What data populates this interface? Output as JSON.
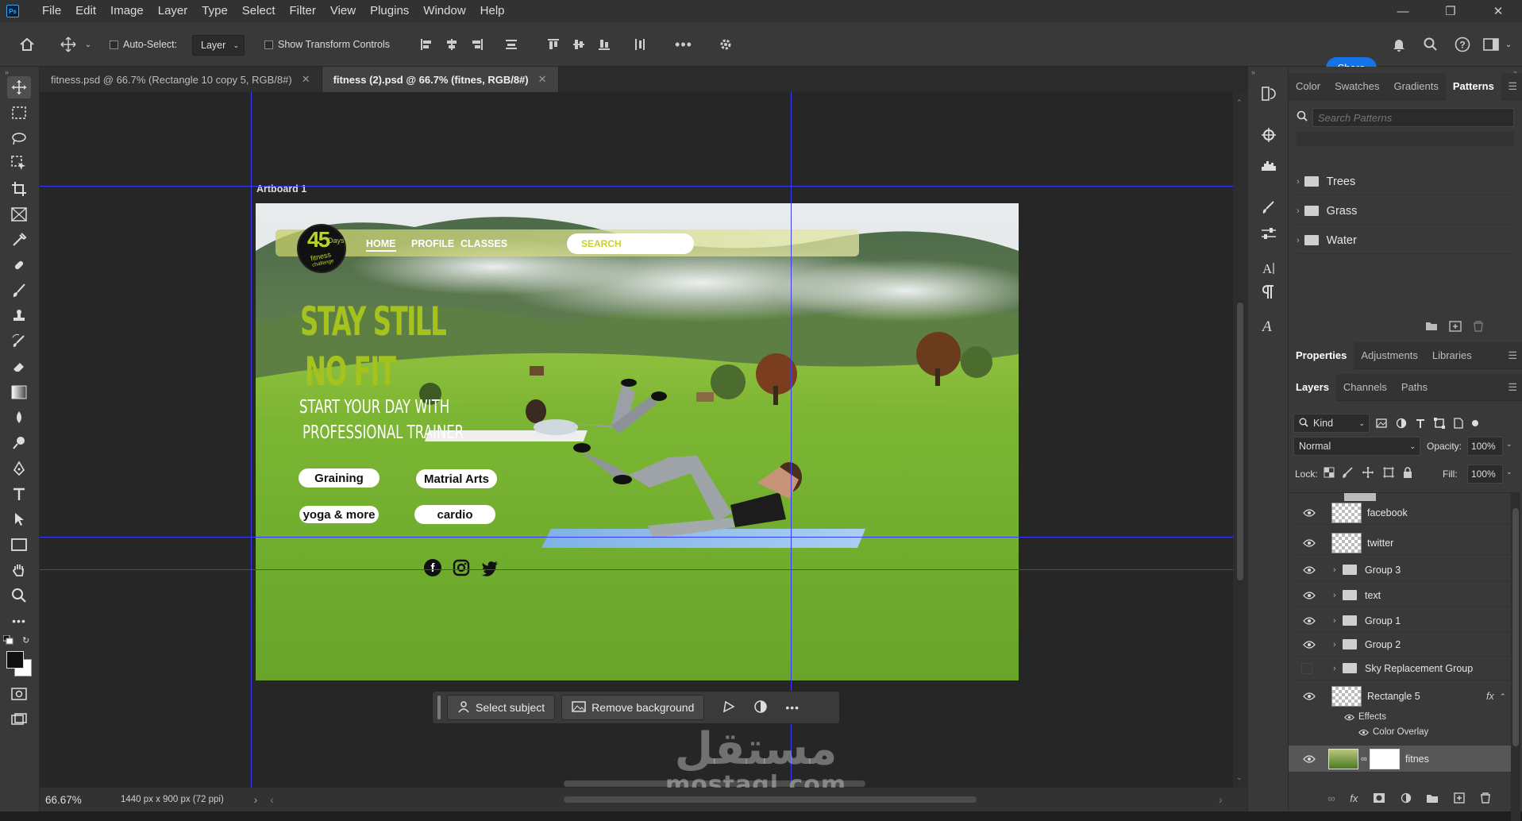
{
  "app": {
    "name": "Photoshop"
  },
  "menubar": {
    "items": [
      "File",
      "Edit",
      "Image",
      "Layer",
      "Type",
      "Select",
      "Filter",
      "View",
      "Plugins",
      "Window",
      "Help"
    ]
  },
  "options_bar": {
    "auto_select_label": "Auto-Select:",
    "auto_select_value": "Layer",
    "show_transform_label": "Show Transform Controls",
    "share_label": "Share"
  },
  "tabs": [
    {
      "label": "fitness.psd @ 66.7% (Rectangle 10 copy 5, RGB/8#)",
      "active": false
    },
    {
      "label": "fitness (2).psd @ 66.7% (fitnes, RGB/8#)",
      "active": true
    }
  ],
  "artboard": {
    "label": "Artboard 1",
    "logo_number": "45",
    "logo_sub": "Days",
    "logo_line2": "fitness",
    "logo_line3": "challenge",
    "nav": [
      "HOME",
      "PROFILE",
      "CLASSES"
    ],
    "search_label": "SEARCH",
    "headline1": "STAY STILL",
    "headline2": "NO FIT",
    "subline1": "START YOUR DAY WITH",
    "subline2": "PROFESSIONAL TRAINER",
    "pills": [
      "Graining",
      "Matrial Arts",
      "yoga & more",
      "cardio"
    ]
  },
  "context_bar": {
    "select_subject": "Select subject",
    "remove_background": "Remove background"
  },
  "status": {
    "zoom": "66.67%",
    "doc_size": "1440 px x 900 px (72 ppi)"
  },
  "top_panel": {
    "tabs": [
      "Color",
      "Swatches",
      "Gradients",
      "Patterns"
    ],
    "active_tab": "Patterns",
    "search_placeholder": "Search Patterns",
    "folders": [
      "Trees",
      "Grass",
      "Water"
    ]
  },
  "mid_panel": {
    "tabs": [
      "Properties",
      "Adjustments",
      "Libraries"
    ]
  },
  "layers_panel": {
    "tabs": [
      "Layers",
      "Channels",
      "Paths"
    ],
    "kind_label": "Kind",
    "blend_mode": "Normal",
    "opacity_label": "Opacity:",
    "opacity_value": "100%",
    "lock_label": "Lock:",
    "fill_label": "Fill:",
    "fill_value": "100%",
    "layers": [
      {
        "name": "facebook",
        "type": "smart"
      },
      {
        "name": "twitter",
        "type": "smart"
      },
      {
        "name": "Group 3",
        "type": "group"
      },
      {
        "name": "text",
        "type": "group"
      },
      {
        "name": "Group 1",
        "type": "group"
      },
      {
        "name": "Group 2",
        "type": "group"
      },
      {
        "name": "Sky Replacement Group",
        "type": "group"
      },
      {
        "name": "Rectangle 5",
        "type": "shape"
      }
    ],
    "effects_label": "Effects",
    "color_overlay_label": "Color Overlay",
    "bottom_layer_name": "fitnes"
  },
  "watermark": {
    "arabic": "مستقل",
    "latin": "mostaql.com"
  },
  "colors": {
    "accent": "#1473e6",
    "headline": "#9fbf1f",
    "guide": "#3a3aff"
  }
}
